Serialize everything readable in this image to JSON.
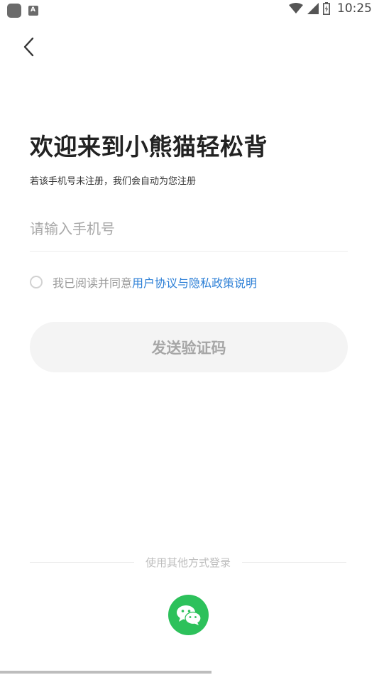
{
  "status_bar": {
    "time": "10:25",
    "icons": [
      "app-icon",
      "app-icon",
      "wifi-icon",
      "cellular-icon",
      "battery-icon"
    ]
  },
  "header": {
    "back_icon": "chevron-left-icon"
  },
  "main": {
    "title": "欢迎来到小熊猫轻松背",
    "subtitle": "若该手机号未注册，我们会自动为您注册",
    "phone_input": {
      "value": "",
      "placeholder": "请输入手机号"
    },
    "agreement": {
      "prefix": "我已阅读并同意",
      "link": "用户协议与隐私政策说明",
      "checked": false
    },
    "send_code_label": "发送验证码"
  },
  "footer": {
    "other_login_label": "使用其他方式登录",
    "wechat_icon": "wechat-icon"
  },
  "colors": {
    "link": "#2c7fd6",
    "wechat": "#2dc15b",
    "button_bg": "#f4f4f4",
    "button_text": "#a6a6a6"
  }
}
